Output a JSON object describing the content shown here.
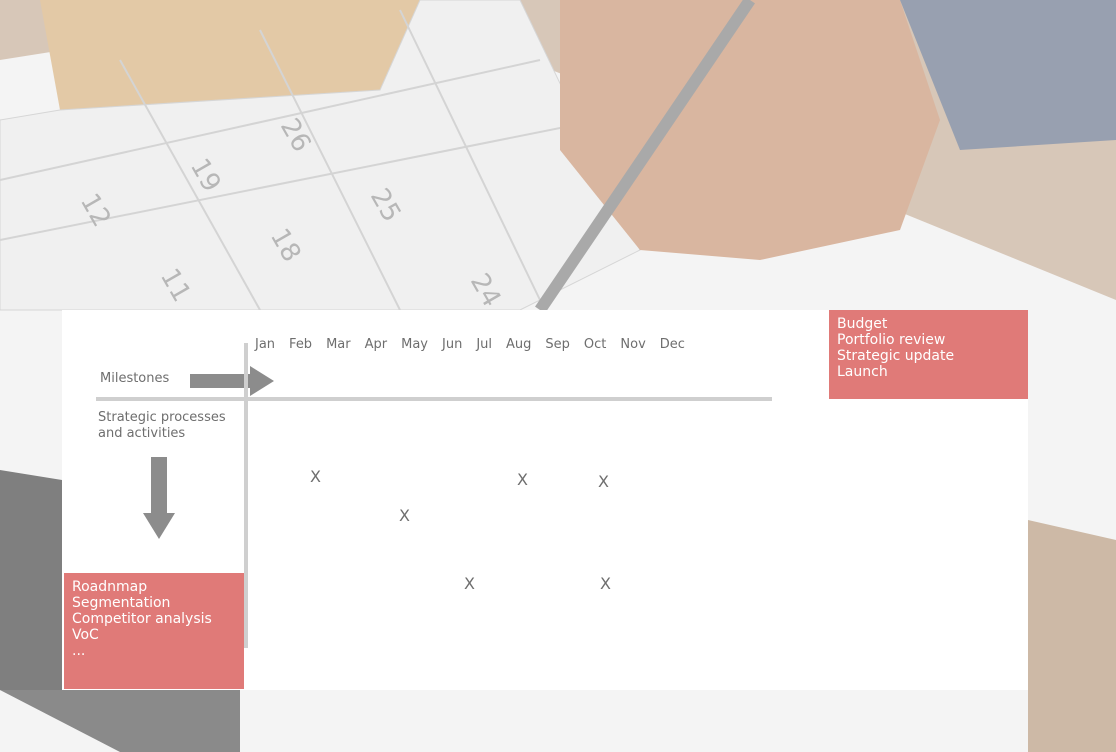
{
  "months": [
    "Jan",
    "Feb",
    "Mar",
    "Apr",
    "May",
    "Jun",
    "Jul",
    "Aug",
    "Sep",
    "Oct",
    "Nov",
    "Dec"
  ],
  "milestones_label": "Milestones",
  "process_label_line1": "Strategic processes",
  "process_label_line2": "and activities",
  "x_mark": "X",
  "top_box": [
    "Budget",
    "Portfolio review",
    "Strategic update",
    "Launch"
  ],
  "left_box": [
    "Roadnmap",
    "Segmentation",
    "Competitor analysis",
    "VoC",
    "..."
  ],
  "colors": {
    "accent": "#e07a78",
    "arrow": "#8c8c8c",
    "line": "#cfcfcf"
  }
}
